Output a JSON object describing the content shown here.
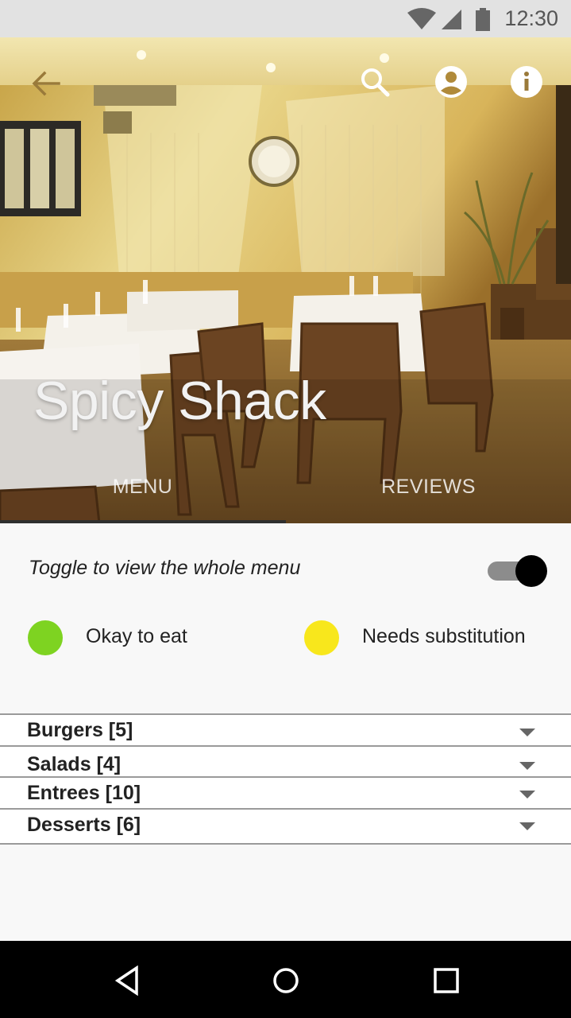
{
  "status_bar": {
    "time": "12:30",
    "icons": [
      "wifi-icon",
      "cell-signal-icon",
      "battery-icon"
    ]
  },
  "toolbar": {
    "icons": [
      "back-arrow-icon",
      "search-icon",
      "account-icon",
      "info-icon"
    ]
  },
  "hero": {
    "title": "Spicy Shack"
  },
  "tabs": [
    {
      "label": "MENU",
      "selected": true
    },
    {
      "label": "REVIEWS",
      "selected": false
    }
  ],
  "filter": {
    "toggle_label": "Toggle to view the whole menu",
    "toggle_on": true
  },
  "legend": [
    {
      "label": "Okay to eat",
      "color": "#7ed321"
    },
    {
      "label": "Needs substitution",
      "color": "#f8e71c"
    }
  ],
  "menu_categories": [
    {
      "label": "Burgers [5]"
    },
    {
      "label": "Salads [4]"
    },
    {
      "label": "Entrees [10]"
    },
    {
      "label": "Desserts [6]"
    }
  ],
  "nav_bar": {
    "icons": [
      "back-triangle-icon",
      "home-circle-icon",
      "recents-square-icon"
    ]
  }
}
